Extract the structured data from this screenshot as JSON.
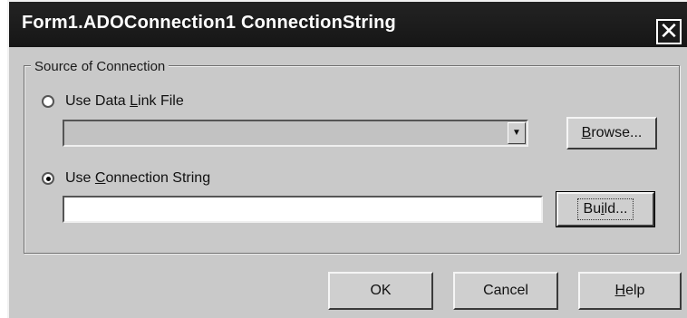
{
  "dialog": {
    "title": "Form1.ADOConnection1 ConnectionString",
    "close_glyph": "✕"
  },
  "group": {
    "label": "Source of Connection"
  },
  "data_link": {
    "label_pre": "Use Data ",
    "label_accel": "L",
    "label_post": "ink File",
    "selected": false,
    "value": "",
    "browse_pre": "",
    "browse_accel": "B",
    "browse_post": "rowse...",
    "dropdown_icon": "chevron-down-icon"
  },
  "conn_string": {
    "label_pre": "Use ",
    "label_accel": "C",
    "label_post": "onnection String",
    "selected": true,
    "value": "",
    "build_pre": "Bu",
    "build_accel": "i",
    "build_post": "ld..."
  },
  "footer": {
    "ok_label": "OK",
    "cancel_label": "Cancel",
    "help_accel": "H",
    "help_post": "elp"
  }
}
